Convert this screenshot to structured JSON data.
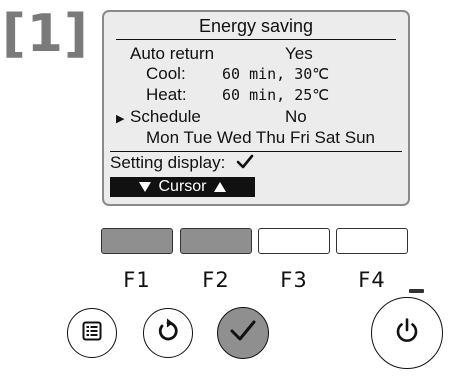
{
  "step_label": "[1]",
  "screen": {
    "title": "Energy saving",
    "auto_return": {
      "label": "Auto return",
      "value": "Yes"
    },
    "cool": {
      "label": "Cool:",
      "value": "60 min, 30℃"
    },
    "heat": {
      "label": "Heat:",
      "value": "60 min, 25℃"
    },
    "schedule": {
      "label": "Schedule",
      "value": "No",
      "selected": true
    },
    "days": "Mon Tue Wed Thu Fri Sat Sun",
    "setting_display_label": "Setting display:",
    "cursor_label": "Cursor"
  },
  "function_keys": [
    {
      "label": "F1",
      "active": true
    },
    {
      "label": "F2",
      "active": true
    },
    {
      "label": "F3",
      "active": false
    },
    {
      "label": "F4",
      "active": false
    }
  ],
  "buttons": {
    "menu_icon": "menu-icon",
    "return_icon": "return-icon",
    "ok_icon": "checkmark-icon",
    "power_icon": "power-icon"
  },
  "colors": {
    "screen_bg": "#ececec",
    "active_key": "#8f8f8f",
    "text": "#111111"
  }
}
